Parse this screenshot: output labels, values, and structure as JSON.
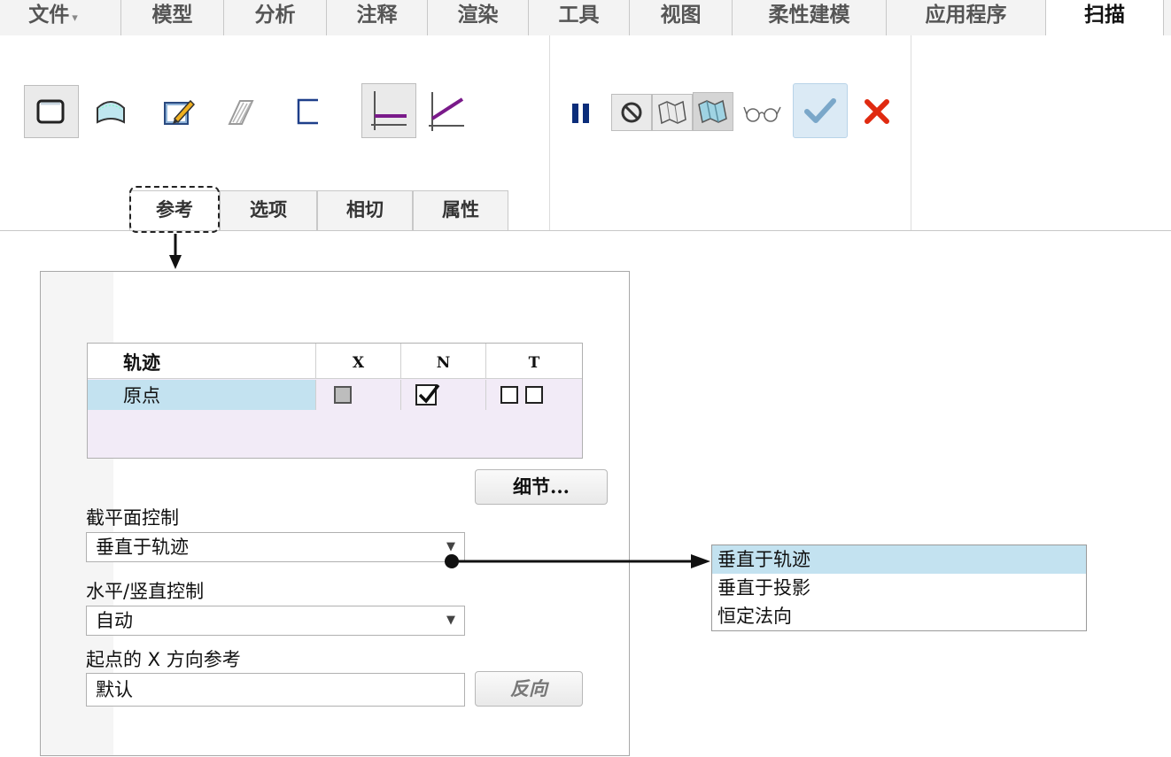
{
  "tabs": [
    {
      "label": "文件"
    },
    {
      "label": "模型"
    },
    {
      "label": "分析"
    },
    {
      "label": "注释"
    },
    {
      "label": "渲染"
    },
    {
      "label": "工具"
    },
    {
      "label": "视图"
    },
    {
      "label": "柔性建模"
    },
    {
      "label": "应用程序"
    },
    {
      "label": "扫描"
    }
  ],
  "file_caret": "▾",
  "subtabs": [
    {
      "label": "参考"
    },
    {
      "label": "选项"
    },
    {
      "label": "相切"
    },
    {
      "label": "属性"
    }
  ],
  "ribbon_icons": [
    "solid-icon",
    "surface-icon",
    "sketch-edit-icon",
    "thin-icon",
    "remove-material-icon",
    "constant-section-icon",
    "variable-section-icon",
    "pause-icon",
    "no-preview-icon",
    "preview-mesh-icon",
    "preview-shaded-icon",
    "glasses-icon",
    "ok-icon",
    "cancel-icon"
  ],
  "colors": {
    "ok": "#7aa7c9",
    "cancel": "#e02a10",
    "pause": "#0b2d7a",
    "selected_row": "#c3e2f0",
    "table_bg": "#f2ebf7"
  },
  "table": {
    "headers": [
      "轨迹",
      "X",
      "N",
      "T"
    ],
    "rows": [
      {
        "name": "原点",
        "x": false,
        "n": true,
        "t": [
          false,
          false
        ]
      }
    ]
  },
  "details_button": "细节...",
  "section_control": {
    "label": "截平面控制",
    "value": "垂直于轨迹"
  },
  "hv_control": {
    "label": "水平/竖直控制",
    "value": "自动"
  },
  "x_ref": {
    "label": "起点的 X 方向参考",
    "value": "默认",
    "button": "反向"
  },
  "dropdown_options": [
    "垂直于轨迹",
    "垂直于投影",
    "恒定法向"
  ]
}
